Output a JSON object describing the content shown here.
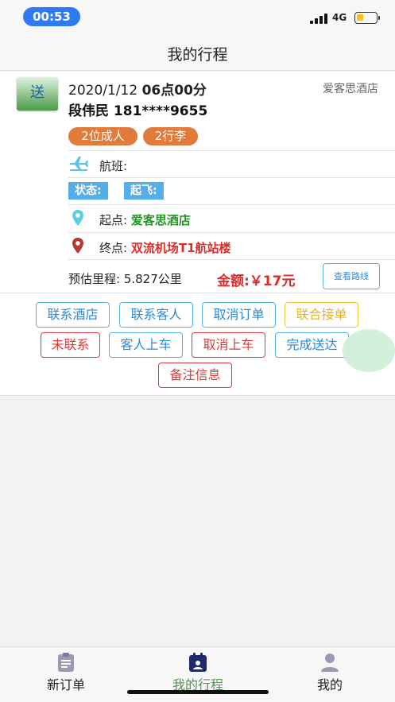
{
  "status_bar": {
    "time": "00:53",
    "network": "4G"
  },
  "header": {
    "title": "我的行程"
  },
  "order": {
    "type_badge": "送",
    "date": "2020/1/12",
    "time": "06点00分",
    "hotel": "爱客思酒店",
    "passenger": "段伟民 181****9655",
    "tags": [
      "2位成人",
      "2行李"
    ],
    "flight_label": "航班:",
    "status_label": "状态:",
    "takeoff_label": "起飞:",
    "origin_label": "起点:",
    "origin_value": "爱客思酒店",
    "destination_label": "终点:",
    "destination_value": "双流机场T1航站楼",
    "mileage": "预估里程: 5.827公里",
    "amount": "金额:￥17元",
    "route_button": "查看路线"
  },
  "actions": {
    "contact_hotel": "联系酒店",
    "contact_guest": "联系客人",
    "cancel_order": "取消订单",
    "joint_pickup": "联合接单",
    "not_contacted": "未联系",
    "guest_boarded": "客人上车",
    "cancel_boarding": "取消上车",
    "complete_delivery": "完成送达",
    "remarks": "备注信息"
  },
  "tabs": [
    {
      "label": "新订单",
      "icon": "clipboard-icon",
      "active": false
    },
    {
      "label": "我的行程",
      "icon": "calendar-icon",
      "active": true
    },
    {
      "label": "我的",
      "icon": "user-icon",
      "active": false
    }
  ],
  "colors": {
    "primary_blue": "#2f7bf6",
    "green": "#249624",
    "red": "#dc2c2c",
    "orange_tag": "#e07b3b",
    "chip_blue": "#56aee8",
    "tab_active": "#5b8d5b"
  }
}
